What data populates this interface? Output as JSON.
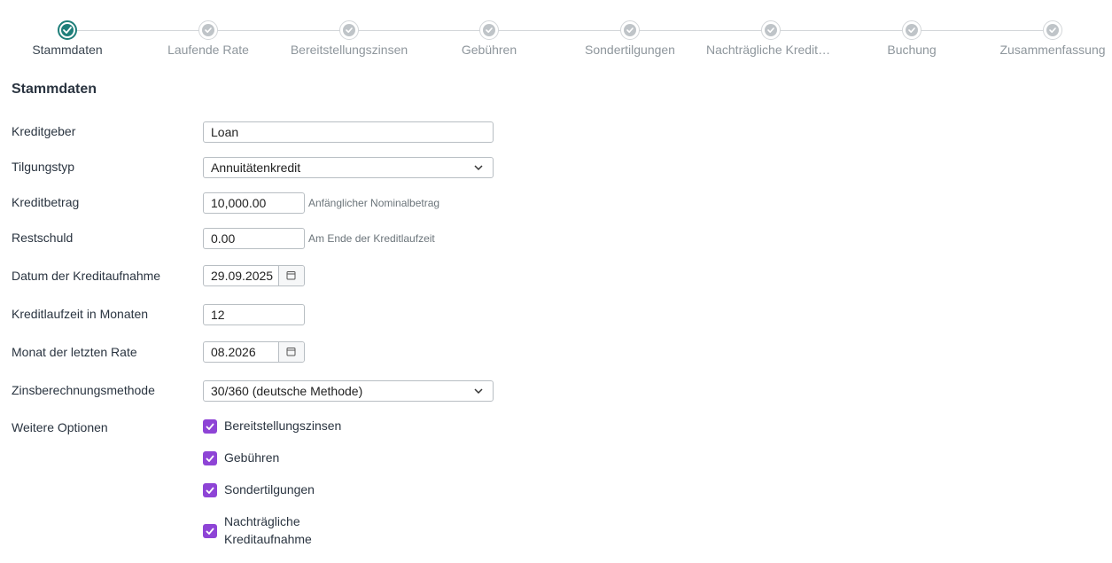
{
  "stepper": {
    "steps": [
      {
        "label": "Stammdaten",
        "state": "active"
      },
      {
        "label": "Laufende Rate",
        "state": "inactive"
      },
      {
        "label": "Bereitstellungszinsen",
        "state": "inactive"
      },
      {
        "label": "Gebühren",
        "state": "inactive"
      },
      {
        "label": "Sondertilgungen",
        "state": "inactive"
      },
      {
        "label": "Nachträgliche Kreditaufnahme",
        "state": "inactive"
      },
      {
        "label": "Buchung",
        "state": "inactive"
      },
      {
        "label": "Zusammenfassung",
        "state": "inactive"
      }
    ],
    "active_color": "#1f7f7a",
    "inactive_color": "#bfc4c8"
  },
  "section_title": "Stammdaten",
  "form": {
    "kreditgeber": {
      "label": "Kreditgeber",
      "value": "Loan"
    },
    "tilgungstyp": {
      "label": "Tilgungstyp",
      "value": "Annuitätenkredit"
    },
    "kreditbetrag": {
      "label": "Kreditbetrag",
      "value": "10,000.00",
      "hint": "Anfänglicher Nominalbetrag"
    },
    "restschuld": {
      "label": "Restschuld",
      "value": "0.00",
      "hint": "Am Ende der Kreditlaufzeit"
    },
    "datum": {
      "label": "Datum der Kreditaufnahme",
      "value": "29.09.2025"
    },
    "laufzeit": {
      "label": "Kreditlaufzeit in Monaten",
      "value": "12"
    },
    "letzte_rate": {
      "label": "Monat der letzten Rate",
      "value": "08.2026"
    },
    "zinsmethode": {
      "label": "Zinsberechnungsmethode",
      "value": "30/360 (deutsche Methode)"
    },
    "weitere_optionen": {
      "label": "Weitere Optionen",
      "options": [
        {
          "label": "Bereitstellungszinsen",
          "checked": true
        },
        {
          "label": "Gebühren",
          "checked": true
        },
        {
          "label": "Sondertilgungen",
          "checked": true
        },
        {
          "label_line1": "Nachträgliche",
          "label_line2": "Kreditaufnahme",
          "checked": true
        }
      ]
    }
  },
  "checkbox_color": "#8e44d6"
}
